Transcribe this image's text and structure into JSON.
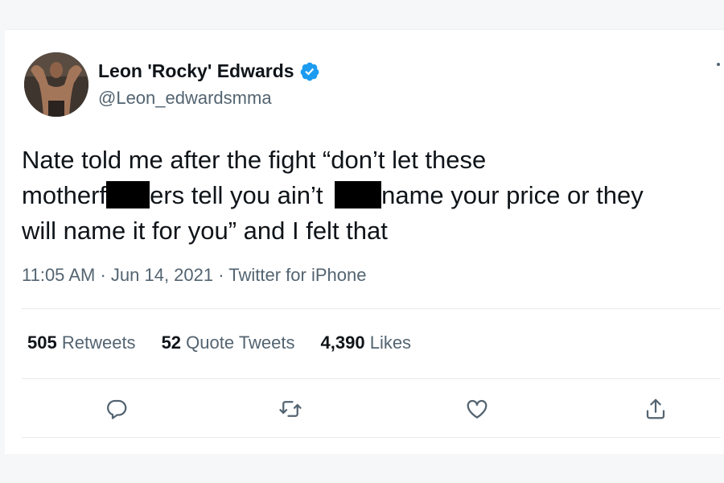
{
  "tweet": {
    "author": {
      "display_name": "Leon 'Rocky' Edwards",
      "handle": "@Leon_edwardsmma",
      "verified": true
    },
    "text": {
      "line1": "Nate told me after the fight “don’t let these",
      "line2_a": "motherf",
      "line2_b": "ers tell you ain’t ",
      "line2_c": "name your price or they",
      "line3": "will name it for you” and I felt that"
    },
    "meta": {
      "time": "11:05 AM",
      "date": "Jun 14, 2021",
      "source": "Twitter for iPhone",
      "separator": " · "
    },
    "stats": {
      "retweets_count": "505",
      "retweets_label": "Retweets",
      "quotes_count": "52",
      "quotes_label": "Quote Tweets",
      "likes_count": "4,390",
      "likes_label": "Likes"
    },
    "icons": {
      "reply": "reply-icon",
      "retweet": "retweet-icon",
      "like": "heart-icon",
      "share": "share-icon",
      "verified": "verified-badge-icon"
    },
    "colors": {
      "verified_blue": "#1d9bf0",
      "text": "#0f1419",
      "secondary": "#536471"
    }
  }
}
